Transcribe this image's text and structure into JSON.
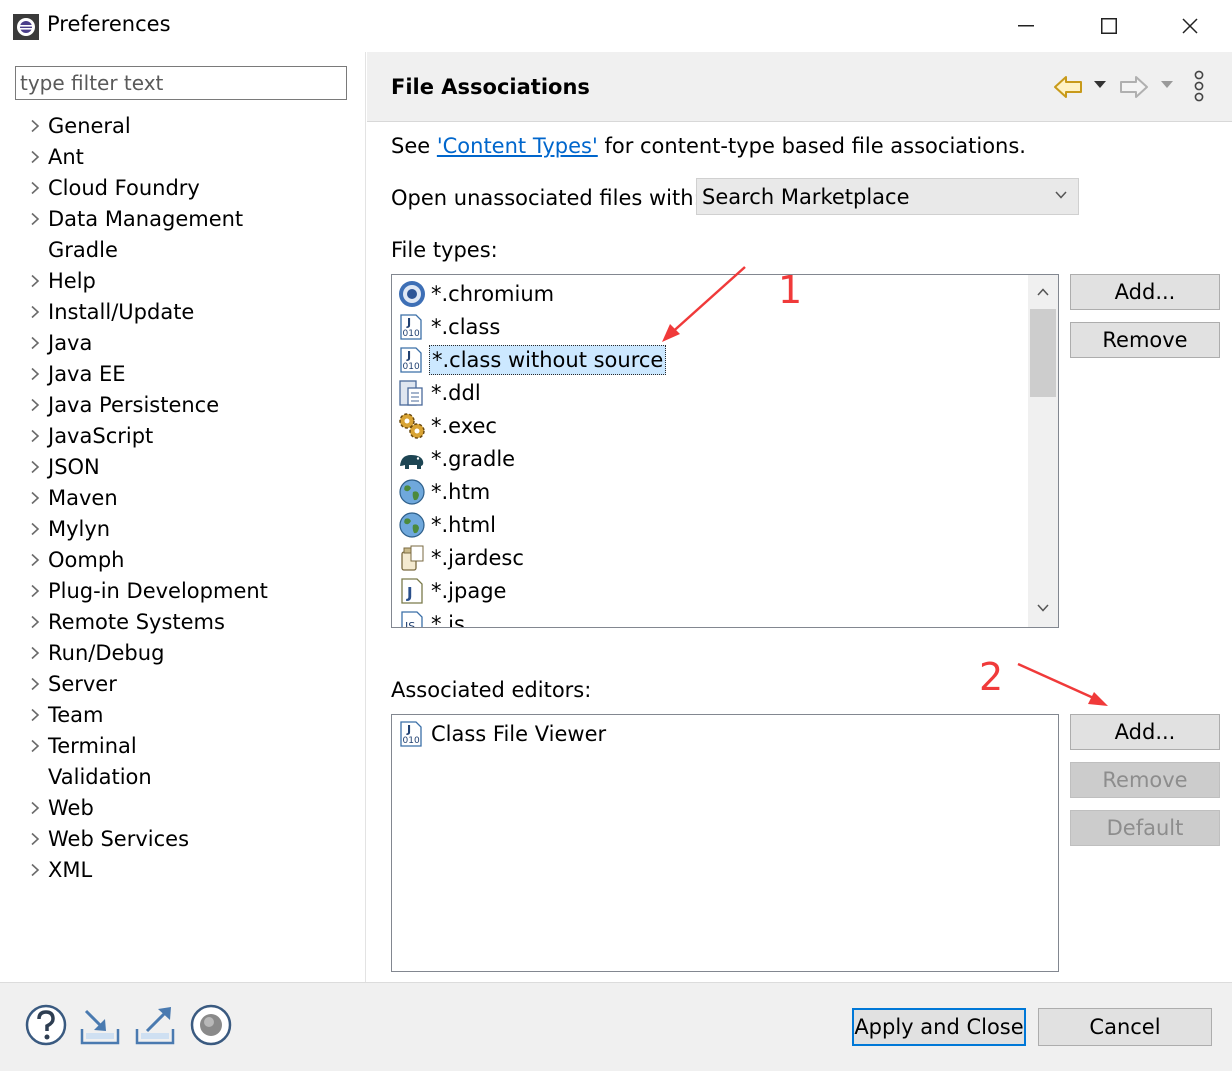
{
  "window": {
    "title": "Preferences",
    "minimize_glyph": "—",
    "maximize_glyph": "☐",
    "close_glyph": "✕"
  },
  "sidebar": {
    "filter_placeholder": "type filter text",
    "items": [
      {
        "label": "General",
        "expandable": true
      },
      {
        "label": "Ant",
        "expandable": true
      },
      {
        "label": "Cloud Foundry",
        "expandable": true
      },
      {
        "label": "Data Management",
        "expandable": true
      },
      {
        "label": "Gradle",
        "expandable": false
      },
      {
        "label": "Help",
        "expandable": true
      },
      {
        "label": "Install/Update",
        "expandable": true
      },
      {
        "label": "Java",
        "expandable": true
      },
      {
        "label": "Java EE",
        "expandable": true
      },
      {
        "label": "Java Persistence",
        "expandable": true
      },
      {
        "label": "JavaScript",
        "expandable": true
      },
      {
        "label": "JSON",
        "expandable": true
      },
      {
        "label": "Maven",
        "expandable": true
      },
      {
        "label": "Mylyn",
        "expandable": true
      },
      {
        "label": "Oomph",
        "expandable": true
      },
      {
        "label": "Plug-in Development",
        "expandable": true
      },
      {
        "label": "Remote Systems",
        "expandable": true
      },
      {
        "label": "Run/Debug",
        "expandable": true
      },
      {
        "label": "Server",
        "expandable": true
      },
      {
        "label": "Team",
        "expandable": true
      },
      {
        "label": "Terminal",
        "expandable": true
      },
      {
        "label": "Validation",
        "expandable": false
      },
      {
        "label": "Web",
        "expandable": true
      },
      {
        "label": "Web Services",
        "expandable": true
      },
      {
        "label": "XML",
        "expandable": true
      }
    ]
  },
  "page": {
    "title": "File Associations",
    "see_prefix": "See ",
    "see_link": "'Content Types'",
    "see_suffix": " for content-type based file associations.",
    "open_label": "Open unassociated files with:",
    "open_value": "Search Marketplace",
    "file_types_label": "File types:",
    "file_types": [
      {
        "label": "*.chromium",
        "icon": "chromium-icon",
        "selected": false
      },
      {
        "label": "*.class",
        "icon": "class-file-icon",
        "selected": false
      },
      {
        "label": "*.class without source",
        "icon": "class-file-icon",
        "selected": true
      },
      {
        "label": "*.ddl",
        "icon": "ddl-file-icon",
        "selected": false
      },
      {
        "label": "*.exec",
        "icon": "gears-icon",
        "selected": false
      },
      {
        "label": "*.gradle",
        "icon": "gradle-elephant-icon",
        "selected": false
      },
      {
        "label": "*.htm",
        "icon": "globe-icon",
        "selected": false
      },
      {
        "label": "*.html",
        "icon": "globe-icon",
        "selected": false
      },
      {
        "label": "*.jardesc",
        "icon": "jar-icon",
        "selected": false
      },
      {
        "label": "*.jpage",
        "icon": "java-page-icon",
        "selected": false
      },
      {
        "label": "*.js",
        "icon": "js-file-icon",
        "selected": false
      }
    ],
    "file_types_add": "Add...",
    "file_types_remove": "Remove",
    "associated_editors_label": "Associated editors:",
    "editors": [
      {
        "label": "Class File Viewer",
        "icon": "class-file-icon"
      }
    ],
    "editors_add": "Add...",
    "editors_remove": "Remove",
    "editors_default": "Default"
  },
  "annotations": {
    "marker_1": "1",
    "marker_2": "2",
    "color": "#f03a3a"
  },
  "footer": {
    "apply_close": "Apply and Close",
    "cancel": "Cancel"
  }
}
